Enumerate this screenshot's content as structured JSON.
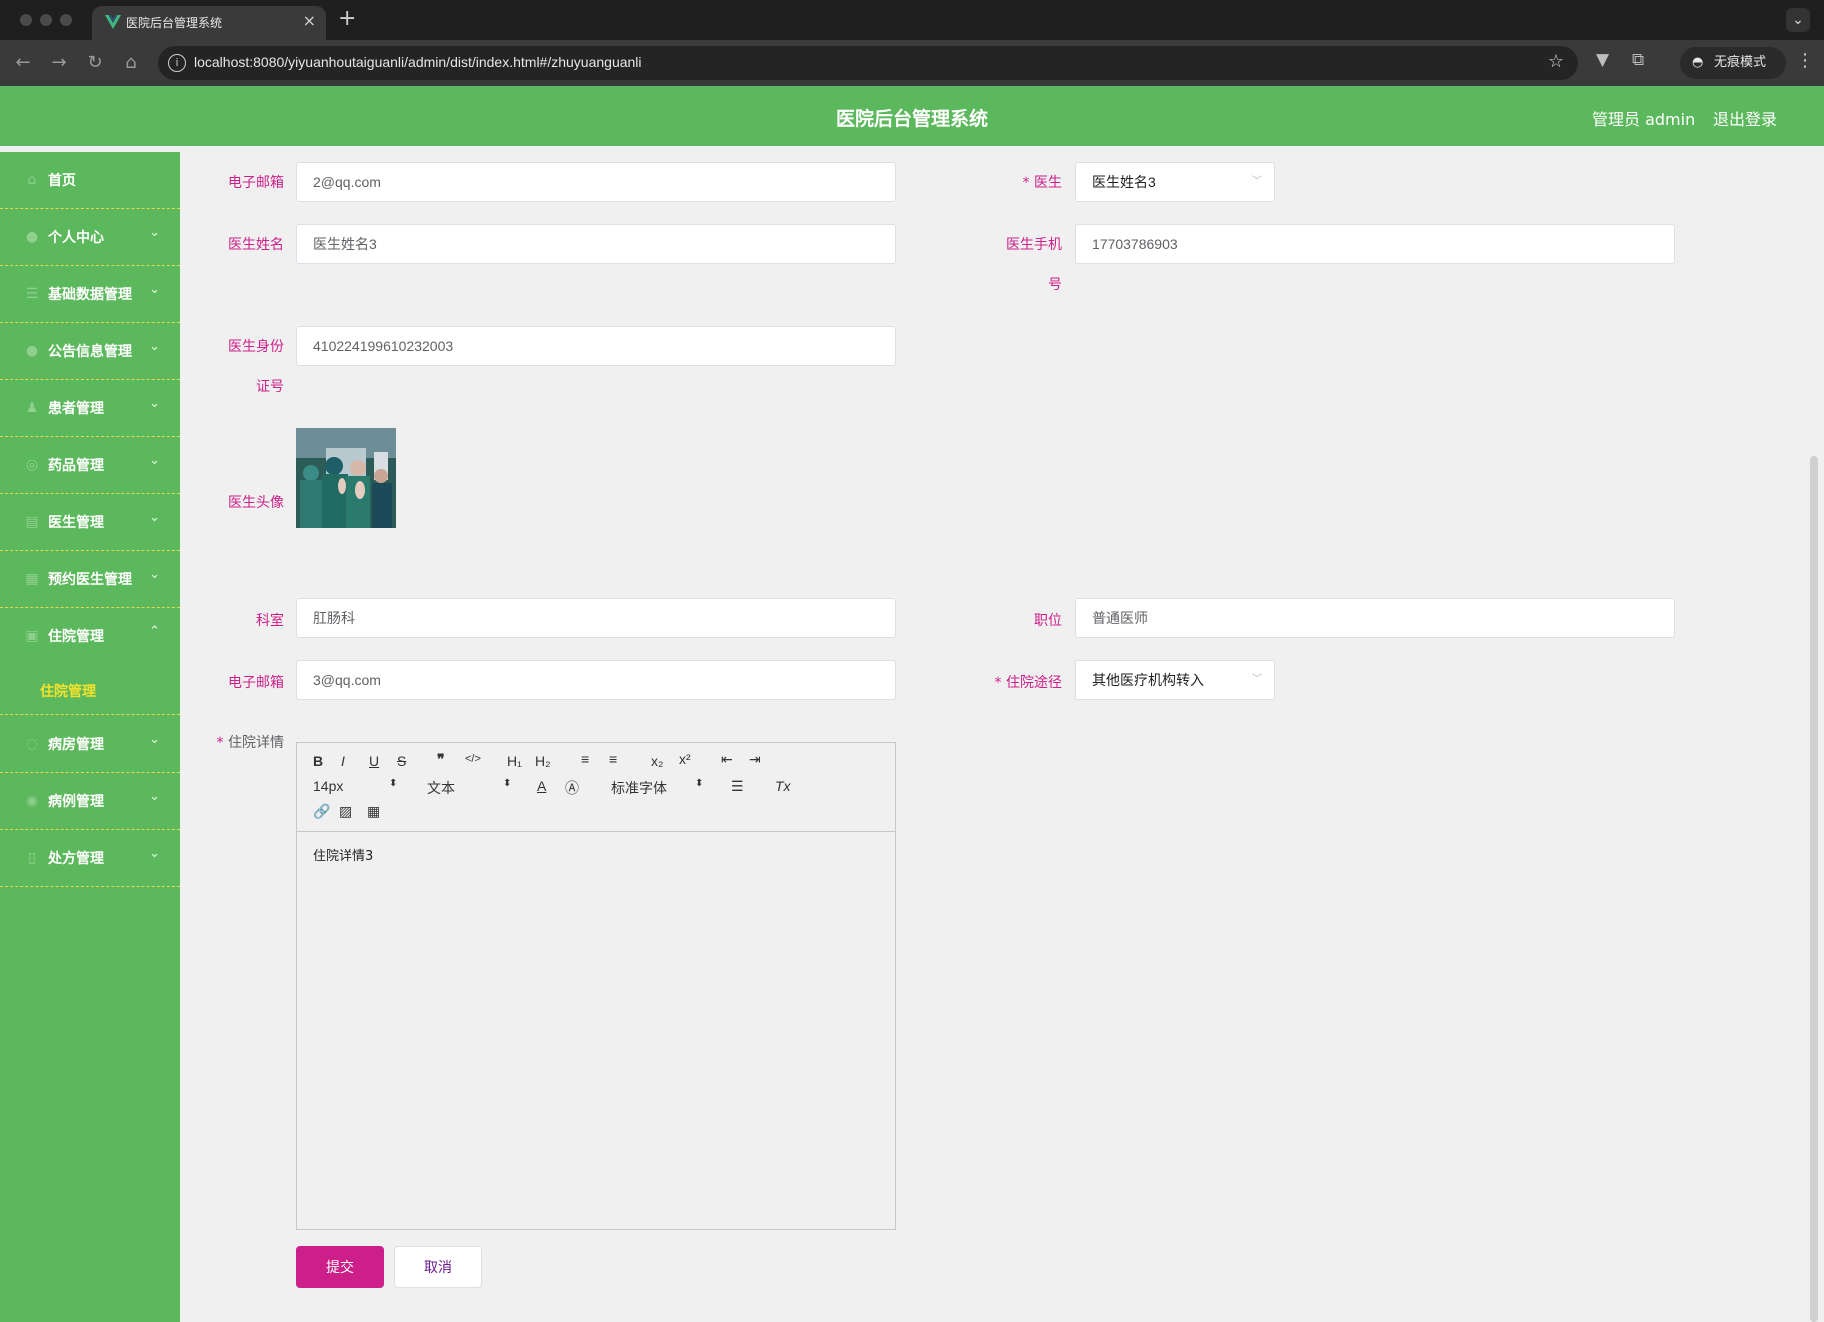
{
  "browser": {
    "tab_title": "医院后台管理系统",
    "url": "localhost:8080/yiyuanhoutaiguanli/admin/dist/index.html#/zhuyuanguanli",
    "incognito_label": "无痕模式"
  },
  "header": {
    "title": "医院后台管理系统",
    "user": "管理员 admin",
    "logout": "退出登录"
  },
  "sidebar": {
    "items": [
      {
        "label": "首页",
        "icon": "home-icon"
      },
      {
        "label": "个人中心",
        "icon": "user-icon"
      },
      {
        "label": "基础数据管理",
        "icon": "list-icon"
      },
      {
        "label": "公告信息管理",
        "icon": "notice-icon"
      },
      {
        "label": "患者管理",
        "icon": "patient-icon"
      },
      {
        "label": "药品管理",
        "icon": "medicine-icon"
      },
      {
        "label": "医生管理",
        "icon": "doctor-icon"
      },
      {
        "label": "预约医生管理",
        "icon": "calendar-icon"
      },
      {
        "label": "住院管理",
        "icon": "bed-icon"
      },
      {
        "label": "病房管理",
        "icon": "ward-icon"
      },
      {
        "label": "病例管理",
        "icon": "case-icon"
      },
      {
        "label": "处方管理",
        "icon": "prescription-icon"
      }
    ],
    "active_sub": "住院管理"
  },
  "form": {
    "email1": {
      "label": "电子邮箱",
      "value": "2@qq.com"
    },
    "doctor": {
      "label": "医生",
      "value": "医生姓名3"
    },
    "doctor_name": {
      "label": "医生姓名",
      "value": "医生姓名3"
    },
    "doctor_phone": {
      "label_line1": "医生手机",
      "label_line2": "号",
      "value": "17703786903"
    },
    "doctor_id": {
      "label_line1": "医生身份",
      "label_line2": "证号",
      "value": "410224199610232003"
    },
    "doctor_avatar": {
      "label": "医生头像"
    },
    "department": {
      "label": "科室",
      "value": "肛肠科"
    },
    "position": {
      "label": "职位",
      "value": "普通医师"
    },
    "email2": {
      "label": "电子邮箱",
      "value": "3@qq.com"
    },
    "admission_route": {
      "label": "住院途径",
      "value": "其他医疗机构转入"
    },
    "detail": {
      "label": "住院详情",
      "value": "住院详情3"
    },
    "required_mark": "*"
  },
  "editor_toolbar": {
    "bold": "B",
    "italic": "I",
    "underline": "U",
    "strike": "S",
    "quote": "❞",
    "code": "</>",
    "h1": "H₁",
    "h2": "H₂",
    "ordered_list": "≡",
    "bullet_list": "≡",
    "subscript": "x₂",
    "superscript": "x²",
    "size": "14px",
    "header": "文本",
    "font": "标准字体",
    "clean": "Tx"
  },
  "buttons": {
    "submit": "提交",
    "cancel": "取消"
  },
  "colors": {
    "header_bg": "#5cb85c",
    "label": "#cc1f8a",
    "submenu_active": "#f2e22e",
    "submit_bg": "#cc1f8a"
  }
}
